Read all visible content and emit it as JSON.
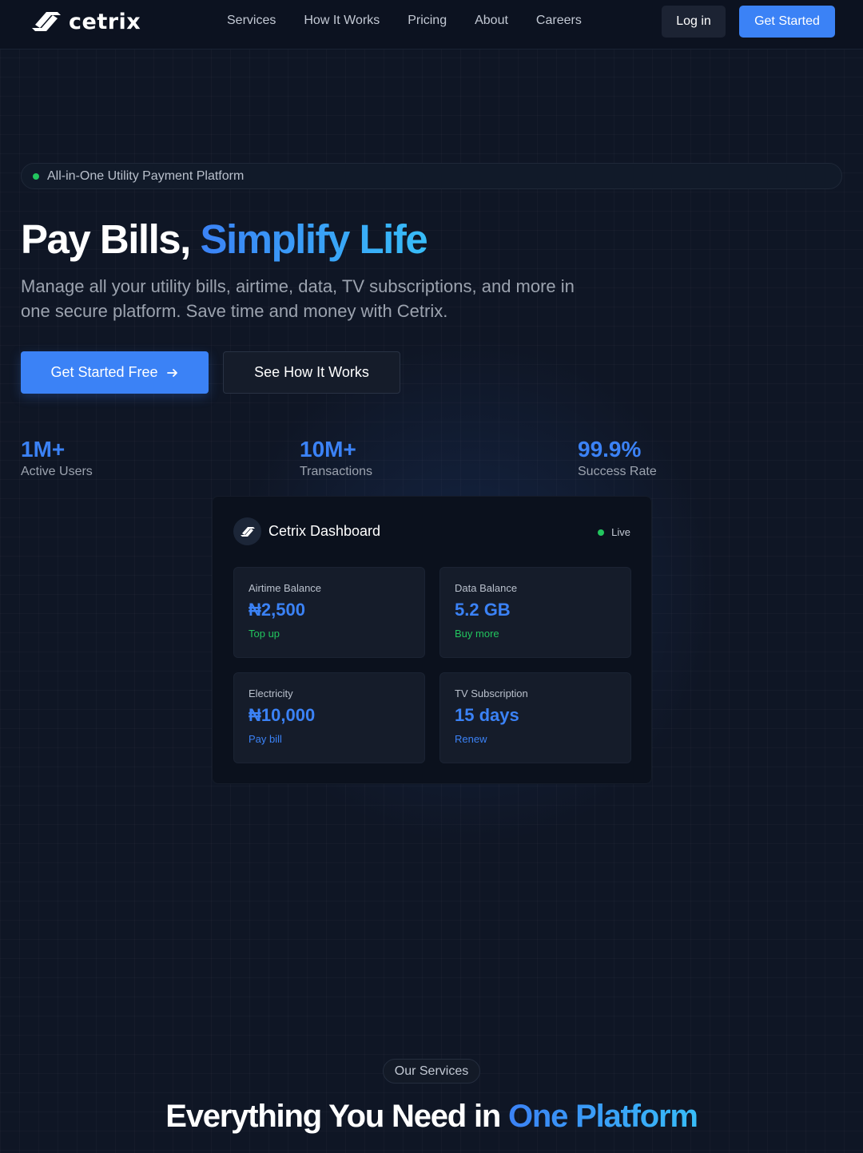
{
  "brand": {
    "name": "cetrix"
  },
  "nav": {
    "links": [
      "Services",
      "How It Works",
      "Pricing",
      "About",
      "Careers"
    ],
    "login_label": "Log in",
    "get_started_label": "Get Started"
  },
  "hero": {
    "badge": "All-in-One Utility Payment Platform",
    "title_plain": "Pay Bills, ",
    "title_highlight": "Simplify Life",
    "subtitle": "Manage all your utility bills, airtime, data, TV subscriptions, and more in one secure platform. Save time and money with Cetrix.",
    "primary_cta": "Get Started Free",
    "secondary_cta": "See How It Works"
  },
  "stats": [
    {
      "value": "1M+",
      "label": "Active Users"
    },
    {
      "value": "10M+",
      "label": "Transactions"
    },
    {
      "value": "99.9%",
      "label": "Success Rate"
    }
  ],
  "dashboard": {
    "title": "Cetrix Dashboard",
    "status": "Live",
    "cards": [
      {
        "label": "Airtime Balance",
        "value": "₦2,500",
        "action": "Top up"
      },
      {
        "label": "Data Balance",
        "value": "5.2 GB",
        "action": "Buy more"
      },
      {
        "label": "Electricity",
        "value": "₦10,000",
        "action": "Pay bill"
      },
      {
        "label": "TV Subscription",
        "value": "15 days",
        "action": "Renew"
      }
    ]
  },
  "services": {
    "badge": "Our Services",
    "title_plain": "Everything You Need in ",
    "title_highlight": "One Platform"
  },
  "colors": {
    "background": "#0f1625",
    "accent": "#3b82f6",
    "accent_light": "#38bdf8",
    "success": "#22c55e"
  },
  "icons": [
    "logo-icon",
    "arrow-right-icon",
    "status-dot-icon"
  ]
}
